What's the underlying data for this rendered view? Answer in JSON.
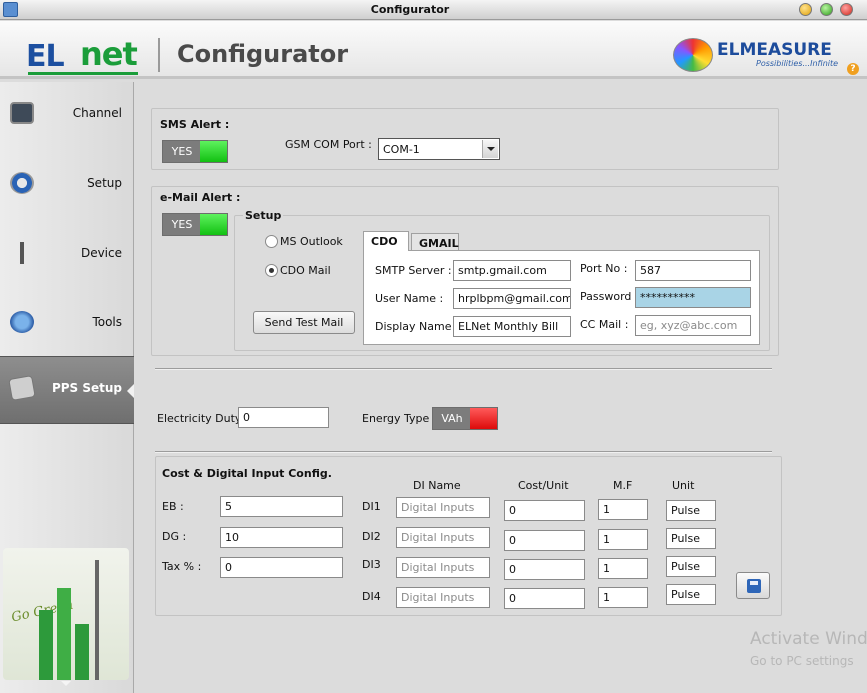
{
  "window": {
    "title": "Configurator"
  },
  "header": {
    "logo_el": "EL",
    "logo_net": "net",
    "app_title": "Configurator",
    "brand": "ELMEASURE",
    "brand_tagline": "Possibilities...Infinite"
  },
  "sidebar": {
    "items": [
      {
        "label": "Channel",
        "icon": "channel-icon"
      },
      {
        "label": "Setup",
        "icon": "setup-icon"
      },
      {
        "label": "Device",
        "icon": "device-icon"
      },
      {
        "label": "Tools",
        "icon": "tools-icon"
      },
      {
        "label": "PPS Setup",
        "icon": "pps-icon",
        "active": true
      }
    ],
    "go_green": "Go Green"
  },
  "sms": {
    "title": "SMS Alert :",
    "toggle": "YES",
    "gsm_label": "GSM COM Port :",
    "gsm_value": "COM-1"
  },
  "email": {
    "title": "e-Mail Alert :",
    "toggle": "YES",
    "setup_title": "Setup",
    "options": {
      "outlook": "MS Outlook",
      "cdo": "CDO Mail",
      "selected": "cdo"
    },
    "send_test": "Send Test Mail",
    "tabs": {
      "cdo": "CDO",
      "gmail": "GMAIL",
      "active": "cdo"
    },
    "smtp_label": "SMTP Server :",
    "smtp_value": "smtp.gmail.com",
    "port_label": "Port No :",
    "port_value": "587",
    "user_label": "User Name :",
    "user_value": "hrplbpm@gmail.com",
    "password_label": "Password :",
    "password_value": "**********",
    "display_label": "Display Name :",
    "display_value": "ELNet Monthly Bill",
    "cc_label": "CC Mail :",
    "cc_placeholder": "eg, xyz@abc.com"
  },
  "duty": {
    "label": "Electricity Duty",
    "value": "0",
    "energy_label": "Energy Type",
    "energy_value": "VAh"
  },
  "cost": {
    "title": "Cost & Digital Input Config.",
    "eb_label": "EB :",
    "eb_value": "5",
    "dg_label": "DG :",
    "dg_value": "10",
    "tax_label": "Tax % :",
    "tax_value": "0",
    "col_di_name": "DI Name",
    "col_cost": "Cost/Unit",
    "col_mf": "M.F",
    "col_unit": "Unit",
    "rows": [
      {
        "di": "DI1",
        "name_placeholder": "Digital Inputs",
        "cost": "0",
        "mf": "1",
        "unit": "Pulse"
      },
      {
        "di": "DI2",
        "name_placeholder": "Digital Inputs",
        "cost": "0",
        "mf": "1",
        "unit": "Pulse"
      },
      {
        "di": "DI3",
        "name_placeholder": "Digital Inputs",
        "cost": "0",
        "mf": "1",
        "unit": "Pulse"
      },
      {
        "di": "DI4",
        "name_placeholder": "Digital Inputs",
        "cost": "0",
        "mf": "1",
        "unit": "Pulse"
      }
    ]
  },
  "watermark": {
    "line1": "Activate Wind",
    "line2": "Go to PC settings"
  }
}
